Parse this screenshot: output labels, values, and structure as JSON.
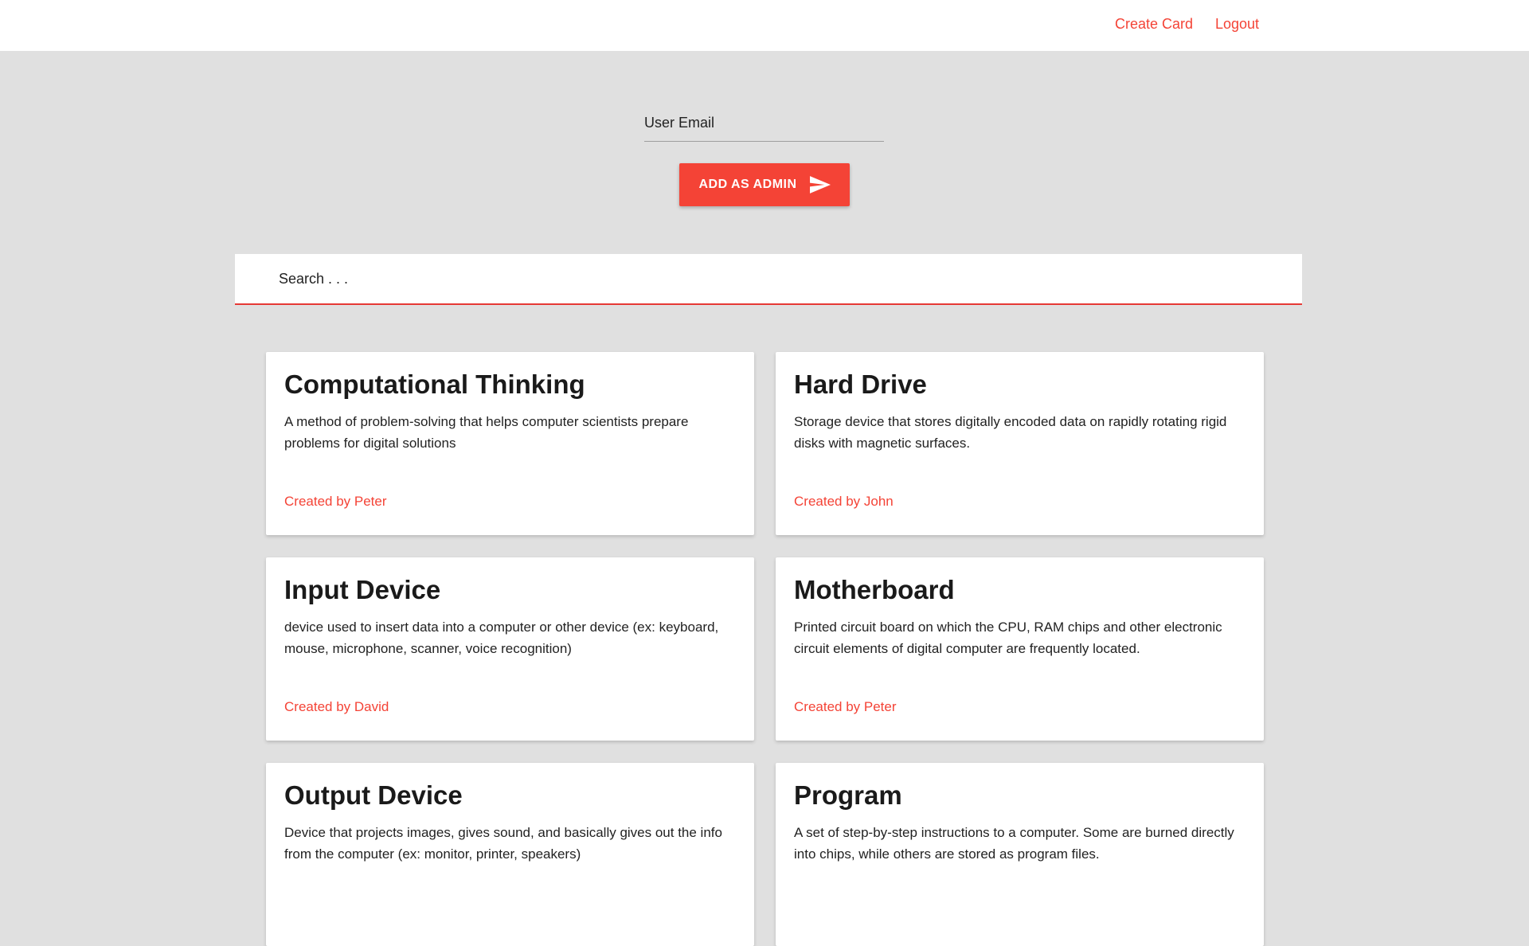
{
  "nav": {
    "create_card": "Create Card",
    "logout": "Logout"
  },
  "admin_form": {
    "email_placeholder": "User Email",
    "email_value": "",
    "submit_label": "ADD AS ADMIN",
    "submit_icon": "send-icon"
  },
  "search": {
    "placeholder": "Search . . .",
    "value": ""
  },
  "cards": [
    {
      "title": "Computational Thinking",
      "description": "A method of problem-solving that helps computer scientists prepare problems for digital solutions",
      "author": "Created by Peter"
    },
    {
      "title": "Hard Drive",
      "description": "Storage device that stores digitally encoded data on rapidly rotating rigid disks with magnetic surfaces.",
      "author": "Created by John"
    },
    {
      "title": "Input Device",
      "description": "device used to insert data into a computer or other device (ex: keyboard, mouse, microphone, scanner, voice recognition)",
      "author": "Created by David"
    },
    {
      "title": "Motherboard",
      "description": "Printed circuit board on which the CPU, RAM chips and other electronic circuit elements of digital computer are frequently located.",
      "author": "Created by Peter"
    },
    {
      "title": "Output Device",
      "description": "Device that projects images, gives sound, and basically gives out the info from the computer (ex: monitor, printer, speakers)",
      "author": ""
    },
    {
      "title": "Program",
      "description": "A set of step-by-step instructions to a computer. Some are burned directly into chips, while others are stored as program files.",
      "author": ""
    }
  ],
  "colors": {
    "accent": "#f44336",
    "background": "#e0e0e0",
    "surface": "#ffffff"
  }
}
